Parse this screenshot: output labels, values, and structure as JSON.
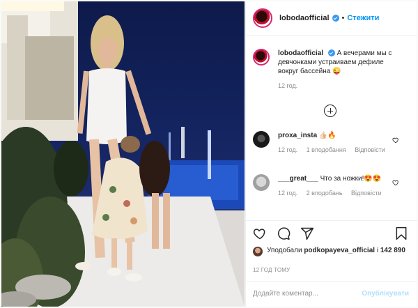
{
  "post": {
    "username": "lobodaofficial",
    "follow_label": "Стежити",
    "separator": "•"
  },
  "caption": {
    "username": "lobodaofficial",
    "text": "А вечерами мы с девчонками устраиваем дефиле вокруг бассейна 😜",
    "age": "12 год."
  },
  "comments": [
    {
      "username": "proxa_insta",
      "text": "👍🏻🔥",
      "age": "12 год.",
      "likes": "1 вподобання",
      "reply": "Відповісти"
    },
    {
      "username": "___great___",
      "text": "Что за ножки!😍😍",
      "age": "12 год.",
      "likes": "2 вподобань",
      "reply": "Відповісти"
    }
  ],
  "actions": {
    "icons": [
      "heart-icon",
      "comment-icon",
      "share-icon",
      "bookmark-icon"
    ]
  },
  "likes": {
    "prefix": "Уподобали",
    "user": "podkopayeva_official",
    "suffix": "і",
    "count": "142 890"
  },
  "timestamp": "12 ГОД ТОМУ",
  "add_comment": {
    "placeholder": "Додайте коментар...",
    "post_label": "Опублікувати"
  },
  "colors": {
    "link_blue": "#0095f6",
    "verified_blue": "#3897f0",
    "muted_gray": "#8e8e8e",
    "post_disabled": "#b2dffc"
  }
}
